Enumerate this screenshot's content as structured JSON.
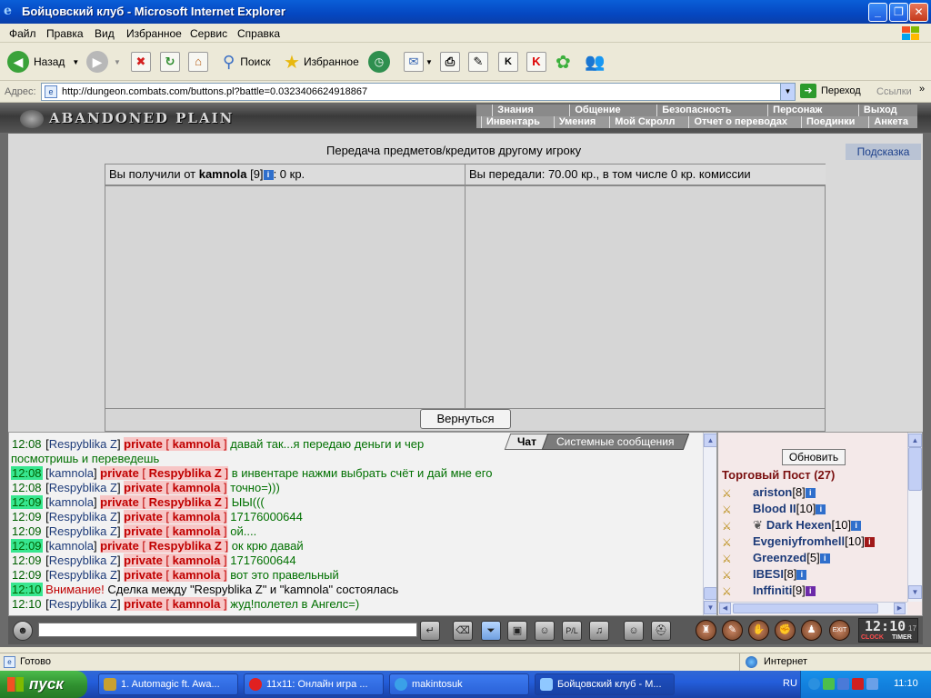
{
  "window": {
    "title": "Бойцовский клуб - Microsoft Internet Explorer"
  },
  "menu": [
    "Файл",
    "Правка",
    "Вид",
    "Избранное",
    "Сервис",
    "Справка"
  ],
  "toolbar": {
    "back_label": "Назад",
    "search_label": "Поиск",
    "favorites_label": "Избранное"
  },
  "address": {
    "label": "Адрес:",
    "url": "http://dungeon.combats.com/buttons.pl?battle=0.0323406624918867",
    "go_label": "Переход",
    "links_label": "Ссылки"
  },
  "game": {
    "logo": "ABANDONED PLAIN",
    "nav_top": [
      "Знания",
      "Общение",
      "Безопасность",
      "Персонаж",
      "Выход"
    ],
    "nav_bottom": [
      "Инвентарь",
      "Умения",
      "Мой Скролл",
      "Отчет о переводах",
      "Поединки",
      "Анкета"
    ],
    "heading": "Передача предметов/кредитов другому игроку",
    "hint_label": "Подсказка",
    "received": {
      "prefix": "Вы получили от",
      "nick": "kamnola",
      "level": "[9]",
      "suffix": ": 0 кр."
    },
    "sent_text": "Вы передали: 70.00 кр., в том числе 0 кр. комиссии",
    "back_button": "Вернуться"
  },
  "chat": {
    "tab_chat": "Чат",
    "tab_system": "Системные сообщения",
    "lines": [
      {
        "time": "12:08",
        "nick": "Respyblika Z",
        "priv": "private",
        "target": "kamnola",
        "msg": "давай так...я передаю деньги и чер"
      },
      {
        "continuation": "посмотришь и переведешь"
      },
      {
        "time": "12:08",
        "nick": "kamnola",
        "priv": "private",
        "target": "Respyblika Z",
        "msg": "в инвентаре нажми выбрать счёт и дай мне его"
      },
      {
        "time": "12:08",
        "nick": "Respyblika Z",
        "priv": "private",
        "target": "kamnola",
        "msg": "точно=)))"
      },
      {
        "time": "12:09",
        "nick": "kamnola",
        "priv": "private",
        "target": "Respyblika Z",
        "msg": "ЫЫ((("
      },
      {
        "time": "12:09",
        "nick": "Respyblika Z",
        "priv": "private",
        "target": "kamnola",
        "msg": "17176000644"
      },
      {
        "time": "12:09",
        "nick": "Respyblika Z",
        "priv": "private",
        "target": "kamnola",
        "msg": "ой...."
      },
      {
        "time": "12:09",
        "nick": "kamnola",
        "priv": "private",
        "target": "Respyblika Z",
        "msg": "ок крю давай"
      },
      {
        "time": "12:09",
        "nick": "Respyblika Z",
        "priv": "private",
        "target": "kamnola",
        "msg": "1717600644"
      },
      {
        "time": "12:09",
        "nick": "Respyblika Z",
        "priv": "private",
        "target": "kamnola",
        "msg": "вот это правельный"
      },
      {
        "time": "12:10",
        "system_warn": "Внимание!",
        "system_text": "Сделка между \"Respyblika Z\" и \"kamnola\" состоялась"
      },
      {
        "time": "12:10",
        "nick": "Respyblika Z",
        "priv": "private",
        "target": "kamnola",
        "msg": "жуд!полетел в Ангелс=)"
      }
    ]
  },
  "room": {
    "refresh_label": "Обновить",
    "title": "Торговый Пост (27)",
    "players": [
      {
        "nick": "ariston",
        "level": "[8]"
      },
      {
        "nick": "Blood II",
        "level": "[10]"
      },
      {
        "nick": "Dark Hexen",
        "level": "[10]"
      },
      {
        "nick": "Evgeniyfromhell",
        "level": "[10]"
      },
      {
        "nick": "Greenzed",
        "level": "[5]"
      },
      {
        "nick": "IBESI",
        "level": "[8]"
      },
      {
        "nick": "Inffiniti",
        "level": "[9]"
      }
    ]
  },
  "clock": {
    "time": "12:10",
    "seconds": "17",
    "clock_label": "CLOCK",
    "timer_label": "TIMER",
    "exit_label": "EXIT"
  },
  "status": {
    "text": "Готово",
    "zone": "Интернет"
  },
  "taskbar": {
    "start_label": "пуск",
    "tasks": [
      "1. Automagic ft. Awa...",
      "11x11: Онлайн игра ...",
      "makintosuk",
      "Бойцовский клуб - M..."
    ],
    "lang": "RU",
    "time": "11:10"
  },
  "colors": {
    "titlebar": "#0547c1",
    "chat_time_highlight": "#37e68f",
    "private_red": "#c00000",
    "nick_blue": "#1c3a78"
  }
}
